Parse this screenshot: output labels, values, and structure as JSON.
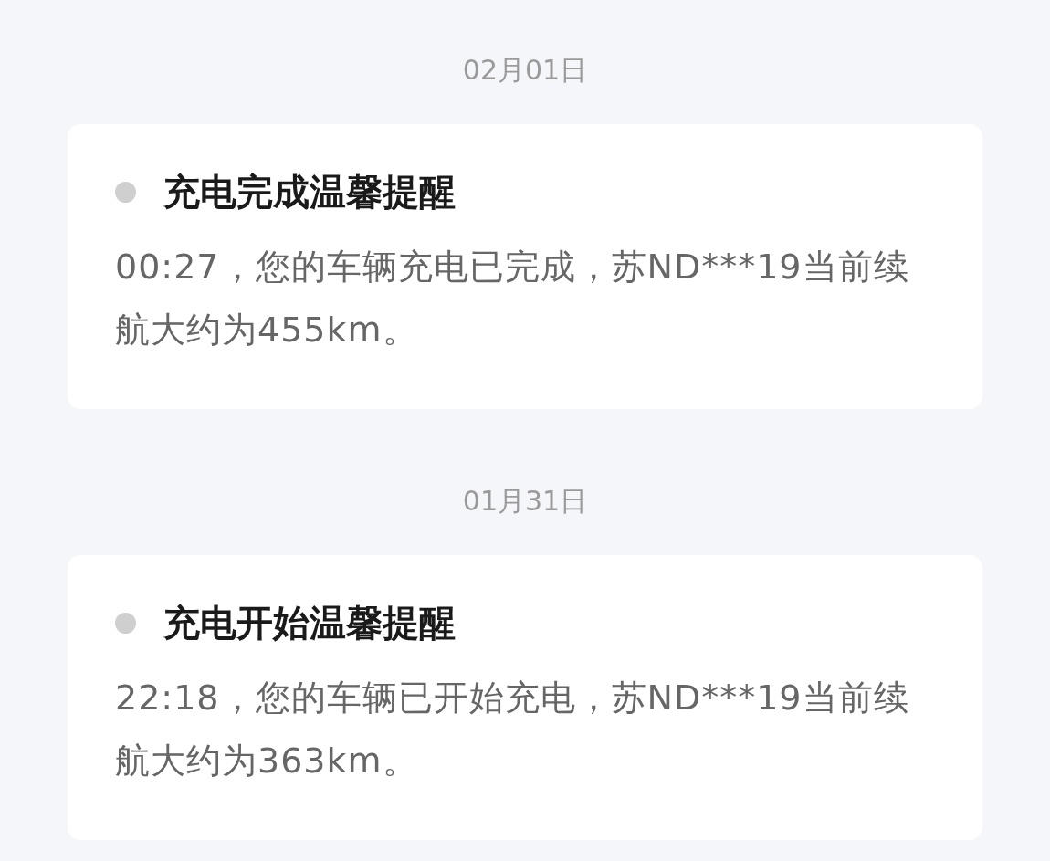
{
  "messages": [
    {
      "date": "02月01日",
      "title": "充电完成温馨提醒",
      "body": "00:27，您的车辆充电已完成，苏ND***19当前续航大约为455km。"
    },
    {
      "date": "01月31日",
      "title": "充电开始温馨提醒",
      "body": "22:18，您的车辆已开始充电，苏ND***19当前续航大约为363km。"
    }
  ]
}
